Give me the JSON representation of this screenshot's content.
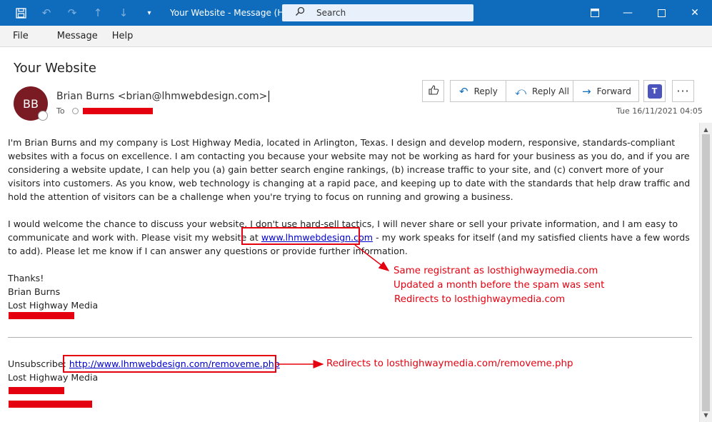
{
  "window": {
    "title": "Your Website  -  Message (HTML)",
    "search_placeholder": "Search"
  },
  "menu": [
    "File",
    "Message",
    "Help"
  ],
  "message": {
    "subject": "Your Website",
    "avatar_initials": "BB",
    "sender": "Brian Burns <brian@lhmwebdesign.com>",
    "to_label": "To",
    "date": "Tue 16/11/2021 04:05"
  },
  "actions": {
    "reply": "Reply",
    "reply_all": "Reply All",
    "forward": "Forward"
  },
  "body": {
    "p1": "I'm Brian Burns and my company is Lost Highway Media, located in Arlington, Texas. I design and develop modern, responsive, standards-compliant websites with a focus on excellence. I am contacting you because your website may not be working as hard for your business as you do, and if you are considering a website update, I can help you (a) gain better search engine rankings, (b) increase traffic to your site, and (c) convert more of your visitors into customers. As you know, web technology is changing at a rapid pace, and keeping up to date with the standards that help draw traffic and hold the attention of visitors can be a challenge when you're trying to focus on running and growing a business.",
    "p2_before": "I would welcome the chance to discuss your website. I don't use hard-sell tactics, I will never share or sell your private information, and I am easy to communicate and work with. Please visit my website at ",
    "p2_link": "www.lhmwebdesign.com",
    "p2_after": " - my work speaks for itself (and my satisfied clients have a few words to add). Please let me know if I can answer any questions or provide further information.",
    "thanks": "Thanks!",
    "sig_name": "Brian Burns",
    "sig_company": "Lost Highway Media",
    "unsub_label": "Unsubscribe: ",
    "unsub_link": "http://www.lhmwebdesign.com/removeme.php",
    "footer_company": "Lost Highway Media"
  },
  "annotations": {
    "note1_line1": "Same registrant as losthighwaymedia.com",
    "note1_line2": "Updated a month before the spam was sent",
    "note1_line3": "Redirects to losthighwaymedia.com",
    "note2": "Redirects to losthighwaymedia.com/removeme.php",
    "color": "#e5000f"
  },
  "colors": {
    "titlebar": "#0f6cbd",
    "avatar": "#7a1a23",
    "link": "#0000cc"
  }
}
